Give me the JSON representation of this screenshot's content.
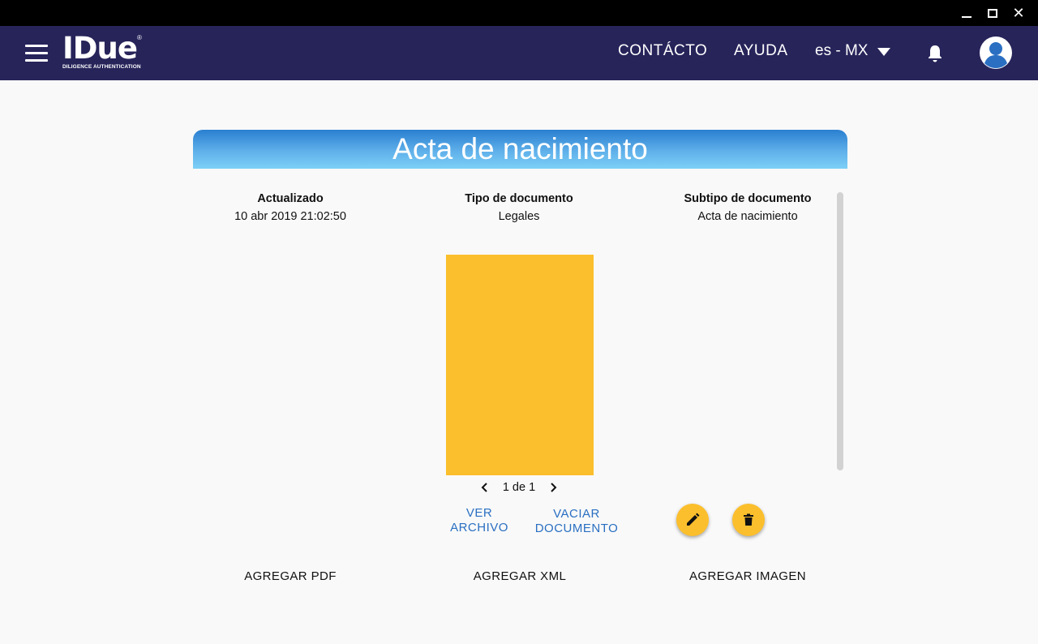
{
  "window": {
    "close_glyph": "✕"
  },
  "header": {
    "logo_text": "IDue",
    "logo_registered": "®",
    "logo_subtitle": "DILIGENCE AUTHENTICATION",
    "nav_contacto": "CONTÁCTO",
    "nav_ayuda": "AYUDA",
    "language": "es - MX",
    "icons": [
      "menu-icon",
      "bell-icon",
      "user-avatar-icon",
      "caret-down-icon"
    ]
  },
  "card": {
    "title": "Acta de nacimiento",
    "updated_label": "Actualizado",
    "updated_value": "10 abr 2019 21:02:50",
    "type_label": "Tipo de documento",
    "type_value": "Legales",
    "subtype_label": "Subtipo de documento",
    "subtype_value": "Acta de nacimiento"
  },
  "pager": {
    "text": "1 de 1"
  },
  "actions": {
    "ver_archivo_line1": "VER",
    "ver_archivo_line2": "ARCHIVO",
    "vaciar_line1": "VACIAR",
    "vaciar_line2": "DOCUMENTO",
    "add_pdf": "AGREGAR PDF",
    "add_xml": "AGREGAR XML",
    "add_image": "AGREGAR IMAGEN"
  },
  "colors": {
    "appbar": "#27245a",
    "accent_yellow": "#fbbf2d",
    "link_blue": "#2a6fc2",
    "header_gradient_top": "#2a7fd0",
    "header_gradient_bottom": "#7cd0f6"
  }
}
